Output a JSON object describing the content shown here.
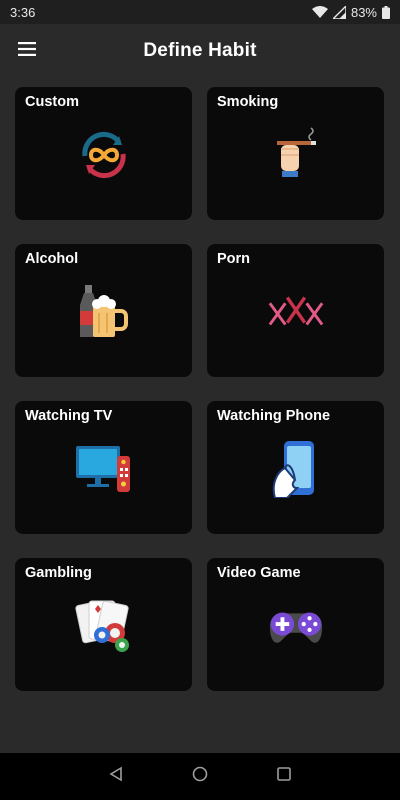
{
  "status_bar": {
    "time": "3:36",
    "battery": "83%",
    "icons": [
      "wifi-icon",
      "signal-icon",
      "battery-icon"
    ]
  },
  "app_bar": {
    "title": "Define Habit",
    "menu_icon": "menu-icon"
  },
  "habits": [
    {
      "label": "Custom",
      "icon": "infinity-cycle-icon"
    },
    {
      "label": "Smoking",
      "icon": "cigarette-hand-icon"
    },
    {
      "label": "Alcohol",
      "icon": "beer-bottle-icon"
    },
    {
      "label": "Porn",
      "icon": "xxx-icon"
    },
    {
      "label": "Watching TV",
      "icon": "tv-remote-icon"
    },
    {
      "label": "Watching Phone",
      "icon": "phone-hand-icon"
    },
    {
      "label": "Gambling",
      "icon": "cards-chips-icon"
    },
    {
      "label": "Video Game",
      "icon": "gamepad-icon"
    }
  ],
  "nav_bar": {
    "icons": [
      "back-icon",
      "home-icon",
      "recents-icon"
    ]
  },
  "colors": {
    "background": "#2a2a2a",
    "card": "#0a0a0a",
    "status_bar": "#1f1f1f",
    "nav_bar": "#000000"
  }
}
